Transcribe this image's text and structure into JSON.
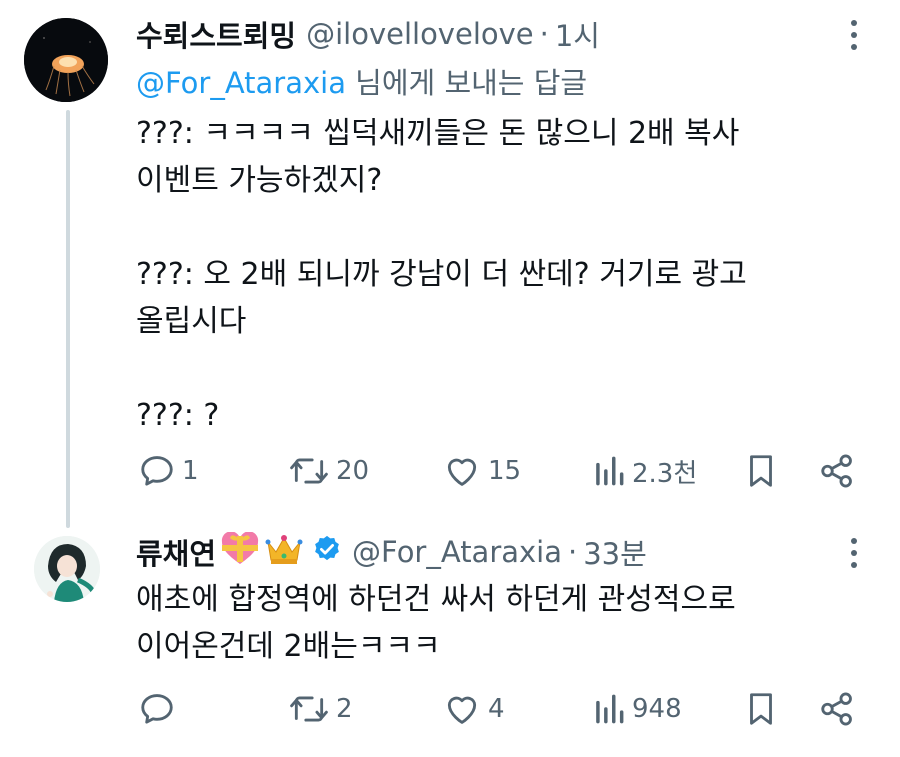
{
  "tweet1": {
    "display_name": "수뢰스트뢰밍",
    "handle": "@ilovellovelove",
    "separator": "·",
    "time": "1시",
    "replying_mention": "@For_Ataraxia",
    "replying_suffix": " 님에게 보내는 답글",
    "text": "???: ㅋㅋㅋㅋ 씹덕새끼들은 돈 많으니 2배 복사\n이벤트 가능하겠지?\n\n???: 오 2배 되니까 강남이 더 싼데? 거기로 광고\n올립시다\n\n???: ?",
    "replies": "1",
    "retweets": "20",
    "likes": "15",
    "views": "2.3천"
  },
  "tweet2": {
    "display_name": "류채연",
    "handle": "@For_Ataraxia",
    "separator": "·",
    "time": "33분",
    "text": "애초에 합정역에 하던건 싸서 하던게 관성적으로\n이어온건데 2배는ㅋㅋㅋ",
    "replies": "",
    "retweets": "2",
    "likes": "4",
    "views": "948"
  },
  "colors": {
    "text": "#0f1419",
    "secondary": "#536471",
    "link": "#1d9bf0",
    "thread_line": "#cfd9de",
    "verified": "#1d9bf0"
  },
  "icons": [
    "reply-icon",
    "retweet-icon",
    "like-icon",
    "views-icon",
    "bookmark-icon",
    "share-icon",
    "more-icon",
    "verified-icon",
    "heart-gift-emoji",
    "crown-emoji"
  ]
}
